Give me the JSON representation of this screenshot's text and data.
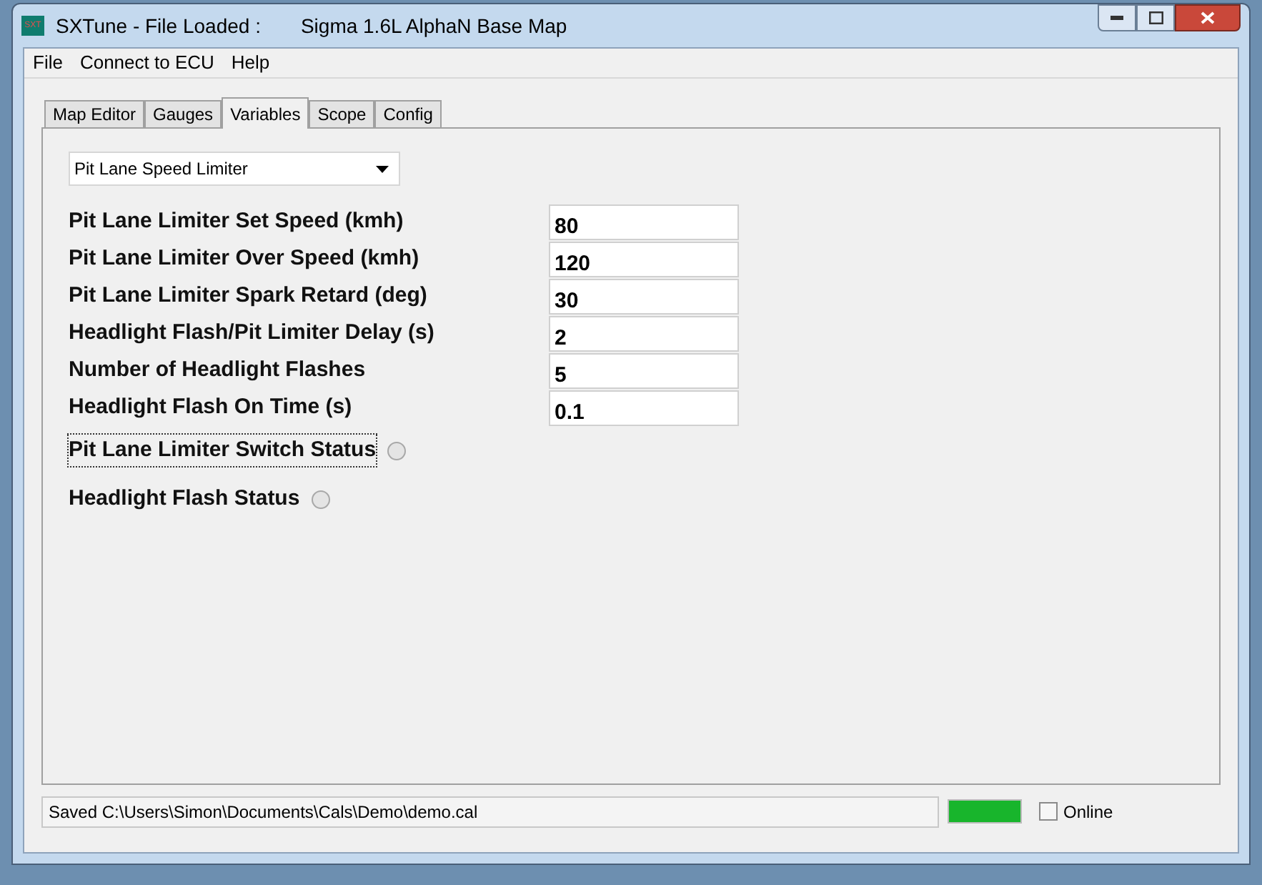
{
  "window": {
    "title": "SXTune - File Loaded :",
    "file_title": "Sigma 1.6L AlphaN Base Map",
    "icon_text": "SXT"
  },
  "menu": [
    "File",
    "Connect to ECU",
    "Help"
  ],
  "tabs": [
    {
      "label": "Map Editor",
      "selected": false
    },
    {
      "label": "Gauges",
      "selected": false
    },
    {
      "label": "Variables",
      "selected": true
    },
    {
      "label": "Scope",
      "selected": false
    },
    {
      "label": "Config",
      "selected": false
    }
  ],
  "dropdown": {
    "value": "Pit Lane Speed Limiter"
  },
  "variables": [
    {
      "kind": "field",
      "label": "Pit Lane Limiter Set Speed (kmh)",
      "value": "80"
    },
    {
      "kind": "field",
      "label": "Pit Lane Limiter Over Speed (kmh)",
      "value": "120"
    },
    {
      "kind": "field",
      "label": "Pit Lane Limiter Spark Retard (deg)",
      "value": "30"
    },
    {
      "kind": "field",
      "label": "Headlight Flash/Pit Limiter Delay (s)",
      "value": "2"
    },
    {
      "kind": "field",
      "label": "Number of Headlight Flashes",
      "value": "5"
    },
    {
      "kind": "field",
      "label": "Headlight Flash On Time (s)",
      "value": "0.1"
    },
    {
      "kind": "status",
      "label": "Pit Lane Limiter Switch Status",
      "on": false,
      "focused": true
    },
    {
      "kind": "status",
      "label": "Headlight Flash Status",
      "on": false,
      "focused": false
    }
  ],
  "status_bar": {
    "text": "Saved C:\\Users\\Simon\\Documents\\Cals\\Demo\\demo.cal",
    "progress": {
      "level": 1
    },
    "online": {
      "label": "Online",
      "checked": false
    }
  }
}
